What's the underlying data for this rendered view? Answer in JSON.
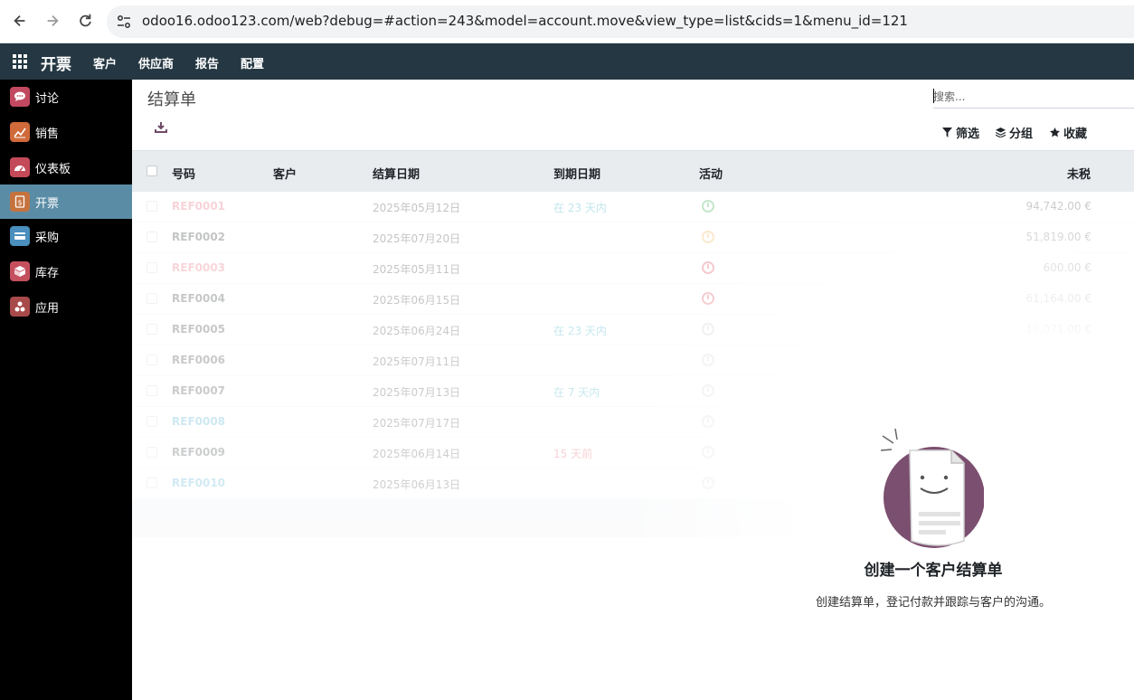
{
  "browser": {
    "url": "odoo16.odoo123.com/web?debug=#action=243&model=account.move&view_type=list&cids=1&menu_id=121"
  },
  "topnav": {
    "brand": "开票",
    "menus": [
      "客户",
      "供应商",
      "报告",
      "配置"
    ]
  },
  "sidebar": {
    "items": [
      {
        "label": "讨论",
        "icon": "chat-icon",
        "color": "#c2495f"
      },
      {
        "label": "销售",
        "icon": "sales-chart-icon",
        "color": "#d06a3b"
      },
      {
        "label": "仪表板",
        "icon": "dashboard-icon",
        "color": "#c44a5a"
      },
      {
        "label": "开票",
        "icon": "invoice-icon",
        "color": "#c5733e"
      },
      {
        "label": "采购",
        "icon": "card-icon",
        "color": "#4a8fbd"
      },
      {
        "label": "库存",
        "icon": "box-icon",
        "color": "#c4505e"
      },
      {
        "label": "应用",
        "icon": "apps-cubes-icon",
        "color": "#a84a4a"
      }
    ],
    "active_index": 3
  },
  "main": {
    "breadcrumb": "结算单",
    "search_placeholder": "搜索...",
    "facets": {
      "filter": "筛选",
      "group": "分组",
      "favorites": "收藏"
    }
  },
  "table": {
    "columns": [
      "号码",
      "客户",
      "结算日期",
      "到期日期",
      "活动",
      "未税"
    ],
    "rows": [
      {
        "number": "REF0001",
        "customer": "",
        "date": "2025年05月12日",
        "due": "在 23 天内",
        "activity": "success",
        "amount": "94,742.00 €"
      },
      {
        "number": "REF0002",
        "customer": "",
        "date": "2025年07月20日",
        "due": "",
        "activity": "warning",
        "amount": "51,819.00 €"
      },
      {
        "number": "REF0003",
        "customer": "",
        "date": "2025年05月11日",
        "due": "",
        "activity": "danger",
        "amount": "600.00 €"
      },
      {
        "number": "REF0004",
        "customer": "",
        "date": "2025年06月15日",
        "due": "",
        "activity": "danger",
        "amount": "61,164.00 €"
      },
      {
        "number": "REF0005",
        "customer": "",
        "date": "2025年06月24日",
        "due": "在 23 天内",
        "activity": "muted",
        "amount": "19,071.00 €"
      },
      {
        "number": "REF0006",
        "customer": "",
        "date": "2025年07月11日",
        "due": "",
        "activity": "muted",
        "amount": ""
      },
      {
        "number": "REF0007",
        "customer": "",
        "date": "2025年07月13日",
        "due": "在 7 天内",
        "activity": "muted",
        "amount": ""
      },
      {
        "number": "REF0008",
        "customer": "",
        "date": "2025年07月17日",
        "due": "",
        "activity": "muted",
        "amount": ""
      },
      {
        "number": "REF0009",
        "customer": "",
        "date": "2025年06月14日",
        "due": "15 天前",
        "activity": "muted",
        "amount": ""
      },
      {
        "number": "REF0010",
        "customer": "",
        "date": "2025年06月13日",
        "due": "",
        "activity": "muted",
        "amount": ""
      }
    ]
  },
  "empty_state": {
    "title": "创建一个客户结算单",
    "description": "创建结算单，登记付款并跟踪与客户的沟通。"
  },
  "colors": {
    "topnav": "#243742",
    "sidebar": "#000000",
    "active_item": "#5b8ca6",
    "ref_red": "#e06070",
    "ref_blue": "#2f9fc8",
    "accent": "#714b67"
  }
}
